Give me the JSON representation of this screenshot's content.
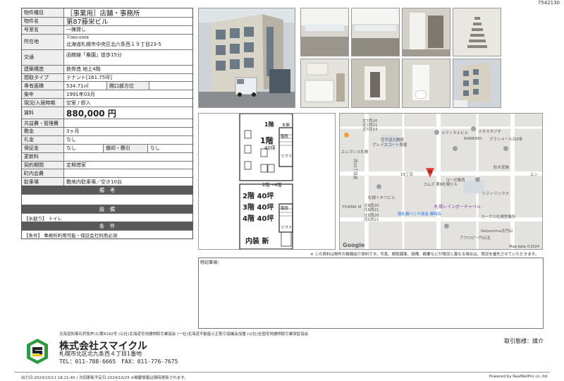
{
  "doc_id": "7542130",
  "table": {
    "labels": {
      "type": "物件種目",
      "name": "物件名",
      "room": "号室名",
      "location": "所在地",
      "access": "交通",
      "structure": "建築構造",
      "layout": "間取タイプ",
      "area": "専有面積",
      "built": "築年",
      "status": "現況/入居時期",
      "rent": "賃料",
      "common": "共益費・管理費",
      "deposit": "敷金",
      "key_money": "礼金",
      "guarantee": "保証金",
      "renewal": "更新料",
      "contract": "契約期間",
      "town_fee": "町内会費",
      "parking": "駐車場"
    },
    "type": "［事業用］店舗・事務所",
    "name": "第87藤栄ビル",
    "room": "一棟貸し",
    "postal": "〒060-0006",
    "address": "北海道札幌市中央区北六条西１９丁目23-5",
    "access": "函館線「桑園」徒歩15分",
    "structure": "鉄骨造 地上4階",
    "layout": "テナント[161.75坪]",
    "area": "534.71㎡",
    "opening_label": "開口部方位",
    "built": "1991年03月",
    "status": "空室 / 即入",
    "rent": "880,000 円",
    "deposit": "3ヶ月",
    "key_money": "なし",
    "guarantee": "なし",
    "amortization_label": "償却・敷引",
    "amortization": "なし",
    "contract": "定期借家",
    "parking": "敷地内駐車場／空き10台",
    "remarks_header": "備　考",
    "facilities_header": "設　備",
    "facilities": "【水廻り】 トイレ",
    "conditions_header": "条　件",
    "conditions": "【条件】 事務所利用可能・保証会社利用必須"
  },
  "plan": {
    "f1_label": "1階",
    "f1_area": "40坪",
    "entrance": "玄関",
    "stairs": "階段",
    "lift": "リフト",
    "floors_label": "2階～4階",
    "f2": "2階 40坪",
    "f3": "3階 40坪",
    "f4": "4階 40坪",
    "interior": "内装 新"
  },
  "map": {
    "labels": [
      "北7西20",
      "北7西21",
      "北7西23",
      "メディカルビル",
      "メタスタジオ",
      "空手道大観館",
      "グランメール北6条",
      "グレイスコート桑園",
      "BANBINO",
      "エレガンス札幌",
      "19丁目",
      "コムズ 第8札幌ビル",
      "鈴木宝飾",
      "西20丁目通",
      "コーポ桑西",
      "シティリンクス",
      "札幌トキワビル",
      "札幌レインボーチャペル",
      "FORMA M",
      "南札幌ベニヤ商会 錦特店",
      "ヨークス札幌営業所",
      "Gelsomina北円山",
      "アクロピー円山北",
      "エン",
      "北6西20",
      "北6西21",
      "北5西20",
      "北5西21"
    ],
    "attribution": "Map data ©2024",
    "logo": "Google"
  },
  "disclaimer": "※ この資料は物件の概略紹介資料です。写真、間取図面、設備、概要などが現況と異なる場合は、現況を優先させていただきます。",
  "notes_label": "特記事項：",
  "assoc": "北海道知事石狩免許(1)第8192号 (公社)北海道宅地建物取引業協会 (一社)北海道不動産公正取引協議会加盟 (公社)全国宅地建物取引業保証協会",
  "company": "株式会社スマイクル",
  "company_address": "札幌市北区北九条西４丁目1番地",
  "tel": "TEL：011-788-6665　FAX：011-776-7675",
  "trade_type": "取引態様：媒介",
  "footer_left": "出力日:2024/10/11 18:21:40 / 次回更新予定日:2024/10/25 ※掲載情報は随時更新されます。",
  "footer_right": "Powered by RealNetPro co.,ltd.",
  "colors": {
    "section_header": "#5a5a5a",
    "label_bg": "#eeeeee",
    "logo_green": "#2e9b3f",
    "pin": "#e8453c"
  }
}
